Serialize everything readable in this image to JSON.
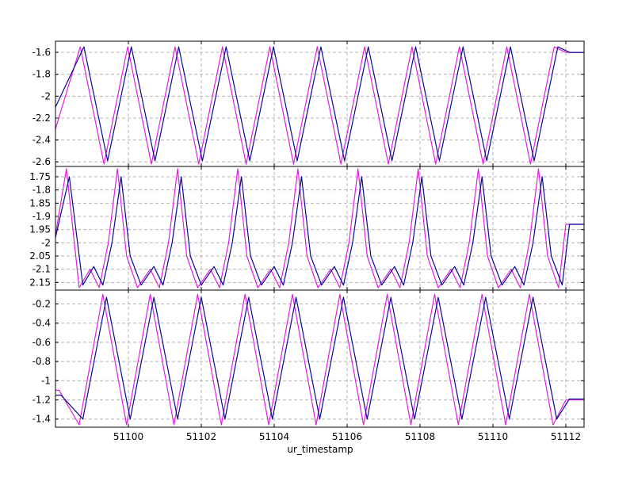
{
  "chart_data": [
    {
      "type": "line",
      "xlabel": "",
      "ylabel": "",
      "xlim": [
        51098.0,
        51112.5
      ],
      "ylim": [
        -2.62,
        -1.52
      ],
      "yticks": [
        -1.6,
        -1.8,
        -2.0,
        -2.2,
        -2.4,
        -2.6
      ],
      "ytick_labels": [
        "-1.6",
        "-1.8",
        "-2",
        "-2.2",
        "-2.4",
        "-2.6"
      ],
      "grid": true,
      "series": [
        {
          "color": "#e020e0",
          "x": [
            51098.0,
            51098.68,
            51099.33,
            51099.98,
            51100.63,
            51101.28,
            51101.93,
            51102.58,
            51103.23,
            51103.88,
            51104.53,
            51105.18,
            51105.83,
            51106.48,
            51107.13,
            51107.78,
            51108.43,
            51109.08,
            51109.73,
            51110.38,
            51111.03,
            51111.68,
            51112.0,
            51112.5
          ],
          "values": [
            -2.3,
            -1.55,
            -2.62,
            -1.55,
            -2.62,
            -1.55,
            -2.62,
            -1.55,
            -2.62,
            -1.55,
            -2.62,
            -1.55,
            -2.62,
            -1.55,
            -2.62,
            -1.55,
            -2.62,
            -1.55,
            -2.62,
            -1.55,
            -2.62,
            -1.55,
            -1.6,
            -1.6
          ]
        },
        {
          "color": "#0a0a90",
          "x": [
            51098.0,
            51098.78,
            51099.43,
            51100.08,
            51100.73,
            51101.38,
            51102.03,
            51102.68,
            51103.33,
            51103.98,
            51104.63,
            51105.28,
            51105.93,
            51106.58,
            51107.23,
            51107.88,
            51108.53,
            51109.18,
            51109.83,
            51110.48,
            51111.13,
            51111.78,
            51112.1,
            51112.5
          ],
          "values": [
            -2.1,
            -1.55,
            -2.59,
            -1.55,
            -2.59,
            -1.55,
            -2.59,
            -1.55,
            -2.59,
            -1.55,
            -2.59,
            -1.55,
            -2.59,
            -1.55,
            -2.59,
            -1.55,
            -2.59,
            -1.55,
            -2.59,
            -1.55,
            -2.59,
            -1.55,
            -1.6,
            -1.6
          ]
        }
      ]
    },
    {
      "type": "line",
      "xlabel": "",
      "ylabel": "",
      "xlim": [
        51098.0,
        51112.5
      ],
      "ylim": [
        2.17,
        1.72
      ],
      "yticks": [
        1.75,
        1.8,
        1.85,
        1.9,
        1.95,
        2.0,
        2.05,
        2.1,
        2.15
      ],
      "ytick_labels": [
        "1.75",
        "-1.8",
        "1.85",
        "-1.9",
        "1.95",
        "-2",
        "2.05",
        "-2.1",
        "2.15"
      ],
      "grid": true,
      "series": [
        {
          "color": "#e020e0",
          "x": [
            51098.0,
            51098.3,
            51098.65,
            51098.95,
            51099.2,
            51099.45,
            51099.7,
            51099.95,
            51100.25,
            51100.6,
            51100.85,
            51101.1,
            51101.35,
            51101.6,
            51101.9,
            51102.25,
            51102.5,
            51102.75,
            51103.0,
            51103.25,
            51103.55,
            51103.9,
            51104.15,
            51104.4,
            51104.65,
            51104.9,
            51105.2,
            51105.55,
            51105.8,
            51106.05,
            51106.3,
            51106.55,
            51106.85,
            51107.2,
            51107.45,
            51107.7,
            51107.95,
            51108.2,
            51108.5,
            51108.85,
            51109.1,
            51109.35,
            51109.6,
            51109.85,
            51110.15,
            51110.5,
            51110.75,
            51111.0,
            51111.25,
            51111.5,
            51111.8,
            51112.0,
            51112.5
          ],
          "values": [
            1.97,
            1.72,
            2.17,
            2.1,
            2.17,
            2.0,
            1.72,
            2.05,
            2.17,
            2.1,
            2.17,
            2.0,
            1.72,
            2.05,
            2.17,
            2.1,
            2.17,
            2.0,
            1.72,
            2.05,
            2.17,
            2.1,
            2.17,
            2.0,
            1.72,
            2.05,
            2.17,
            2.1,
            2.17,
            2.0,
            1.72,
            2.05,
            2.17,
            2.1,
            2.17,
            2.0,
            1.72,
            2.05,
            2.17,
            2.1,
            2.17,
            2.0,
            1.72,
            2.05,
            2.17,
            2.1,
            2.17,
            2.0,
            1.72,
            2.05,
            2.17,
            1.93,
            1.93
          ]
        },
        {
          "color": "#0a0a90",
          "x": [
            51098.0,
            51098.38,
            51098.75,
            51099.05,
            51099.3,
            51099.55,
            51099.8,
            51100.05,
            51100.35,
            51100.7,
            51100.95,
            51101.2,
            51101.45,
            51101.7,
            51102.0,
            51102.35,
            51102.6,
            51102.85,
            51103.1,
            51103.35,
            51103.65,
            51104.0,
            51104.25,
            51104.5,
            51104.75,
            51105.0,
            51105.3,
            51105.65,
            51105.9,
            51106.15,
            51106.4,
            51106.65,
            51106.95,
            51107.3,
            51107.55,
            51107.8,
            51108.05,
            51108.3,
            51108.6,
            51108.95,
            51109.2,
            51109.45,
            51109.7,
            51109.95,
            51110.25,
            51110.6,
            51110.85,
            51111.1,
            51111.35,
            51111.6,
            51111.9,
            51112.1,
            51112.5
          ],
          "values": [
            1.98,
            1.75,
            2.16,
            2.09,
            2.16,
            2.0,
            1.75,
            2.05,
            2.16,
            2.09,
            2.16,
            2.0,
            1.75,
            2.05,
            2.16,
            2.09,
            2.16,
            2.0,
            1.75,
            2.05,
            2.16,
            2.09,
            2.16,
            2.0,
            1.75,
            2.05,
            2.16,
            2.09,
            2.16,
            2.0,
            1.75,
            2.05,
            2.16,
            2.09,
            2.16,
            2.0,
            1.75,
            2.05,
            2.16,
            2.09,
            2.16,
            2.0,
            1.75,
            2.05,
            2.16,
            2.09,
            2.16,
            2.0,
            1.75,
            2.05,
            2.16,
            1.93,
            1.93
          ]
        }
      ]
    },
    {
      "type": "line",
      "xlabel": "ur_timestamp",
      "ylabel": "",
      "xlim": [
        51098.0,
        51112.5
      ],
      "xticks": [
        51100,
        51102,
        51104,
        51106,
        51108,
        51110,
        51112
      ],
      "xtick_labels": [
        "51100",
        "51102",
        "51104",
        "51106",
        "51108",
        "51110",
        "51112"
      ],
      "ylim": [
        -1.46,
        -0.08
      ],
      "yticks": [
        -0.2,
        -0.4,
        -0.6,
        -0.8,
        -1.0,
        -1.2,
        -1.4
      ],
      "ytick_labels": [
        "-0.2",
        "-0.4",
        "-0.6",
        "-0.8",
        "-1",
        "-1.2",
        "-1.4"
      ],
      "grid": true,
      "series": [
        {
          "color": "#e020e0",
          "x": [
            51098.0,
            51098.1,
            51098.65,
            51099.3,
            51099.95,
            51100.6,
            51101.25,
            51101.9,
            51102.55,
            51103.2,
            51103.85,
            51104.5,
            51105.15,
            51105.8,
            51106.45,
            51107.1,
            51107.75,
            51108.4,
            51109.05,
            51109.7,
            51110.35,
            51111.0,
            51111.65,
            51112.0,
            51112.5
          ],
          "values": [
            -1.1,
            -1.1,
            -1.46,
            -0.1,
            -1.46,
            -0.1,
            -1.46,
            -0.1,
            -1.46,
            -0.1,
            -1.46,
            -0.1,
            -1.46,
            -0.1,
            -1.46,
            -0.1,
            -1.46,
            -0.1,
            -1.46,
            -0.1,
            -1.46,
            -0.1,
            -1.46,
            -1.2,
            -1.2
          ]
        },
        {
          "color": "#0a0a90",
          "x": [
            51098.0,
            51098.15,
            51098.75,
            51099.4,
            51100.05,
            51100.7,
            51101.35,
            51102.0,
            51102.65,
            51103.3,
            51103.95,
            51104.6,
            51105.25,
            51105.9,
            51106.55,
            51107.2,
            51107.85,
            51108.5,
            51109.15,
            51109.8,
            51110.45,
            51111.1,
            51111.75,
            51112.1,
            51112.5
          ],
          "values": [
            -1.15,
            -1.15,
            -1.4,
            -0.13,
            -1.4,
            -0.13,
            -1.4,
            -0.13,
            -1.4,
            -0.13,
            -1.4,
            -0.13,
            -1.4,
            -0.13,
            -1.4,
            -0.13,
            -1.4,
            -0.13,
            -1.4,
            -0.13,
            -1.4,
            -0.13,
            -1.4,
            -1.19,
            -1.19
          ]
        }
      ]
    }
  ],
  "axis_title": "ur_timestamp"
}
